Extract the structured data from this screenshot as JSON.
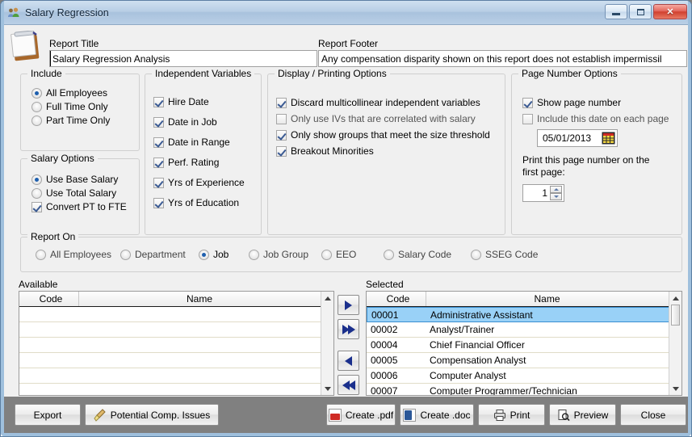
{
  "window": {
    "title": "Salary Regression",
    "icon": "people-group-icon",
    "minimize_label": "Minimize",
    "maximize_label": "Maximize",
    "close_label": "✕"
  },
  "report": {
    "title_label": "Report Title",
    "title_value": "Salary Regression Analysis",
    "footer_label": "Report Footer",
    "footer_value": "Any compensation disparity shown on this report does not establish impermissil"
  },
  "include_group": {
    "title": "Include",
    "options": [
      {
        "label": "All Employees",
        "selected": true
      },
      {
        "label": "Full Time Only",
        "selected": false
      },
      {
        "label": "Part Time Only",
        "selected": false
      }
    ]
  },
  "salary_options_group": {
    "title": "Salary Options",
    "radios": [
      {
        "label": "Use Base Salary",
        "selected": true
      },
      {
        "label": "Use Total Salary",
        "selected": false
      }
    ],
    "checkbox": {
      "label": "Convert PT to FTE",
      "checked": true
    }
  },
  "independent_variables_group": {
    "title": "Independent Variables",
    "options": [
      {
        "label": "Hire Date",
        "checked": true
      },
      {
        "label": "Date in Job",
        "checked": true
      },
      {
        "label": "Date in Range",
        "checked": true
      },
      {
        "label": "Perf. Rating",
        "checked": true
      },
      {
        "label": "Yrs of Experience",
        "checked": true
      },
      {
        "label": "Yrs of Education",
        "checked": true
      }
    ]
  },
  "display_printing_group": {
    "title": "Display / Printing Options",
    "options": [
      {
        "label": "Discard multicollinear independent variables",
        "checked": true
      },
      {
        "label": "Only use IVs that are correlated with salary",
        "checked": false
      },
      {
        "label": "Only show groups that meet the size threshold",
        "checked": true
      },
      {
        "label": "Breakout Minorities",
        "checked": true
      }
    ]
  },
  "page_number_group": {
    "title": "Page Number Options",
    "show_page_number": {
      "label": "Show page number",
      "checked": true
    },
    "include_date": {
      "label": "Include this date on each page",
      "checked": false
    },
    "date_value": "05/01/2013",
    "calendar_icon": "calendar-icon",
    "first_page_label_line1": "Print this page number on the",
    "first_page_label_line2": "first page:",
    "first_page_value": "1"
  },
  "report_on_group": {
    "title": "Report On",
    "options": [
      {
        "label": "All Employees",
        "selected": false
      },
      {
        "label": "Department",
        "selected": false
      },
      {
        "label": "Job",
        "selected": true
      },
      {
        "label": "Job Group",
        "selected": false
      },
      {
        "label": "EEO",
        "selected": false
      },
      {
        "label": "Salary Code",
        "selected": false
      },
      {
        "label": "SSEG Code",
        "selected": false
      }
    ]
  },
  "available_list": {
    "label": "Available",
    "columns": [
      "Code",
      "Name"
    ],
    "rows": []
  },
  "selected_list": {
    "label": "Selected",
    "columns": [
      "Code",
      "Name"
    ],
    "rows": [
      {
        "code": "00001",
        "name": "Administrative Assistant",
        "selected": true
      },
      {
        "code": "00002",
        "name": "Analyst/Trainer",
        "selected": false
      },
      {
        "code": "00004",
        "name": "Chief Financial Officer",
        "selected": false
      },
      {
        "code": "00005",
        "name": "Compensation Analyst",
        "selected": false
      },
      {
        "code": "00006",
        "name": "Computer Analyst",
        "selected": false
      },
      {
        "code": "00007",
        "name": "Computer Programmer/Technician",
        "selected": false
      }
    ]
  },
  "transfer_buttons": [
    {
      "name": "move-right-button",
      "glyph": "▶"
    },
    {
      "name": "move-all-right-button",
      "glyph": "▶▶"
    },
    {
      "name": "move-left-button",
      "glyph": "◀"
    },
    {
      "name": "move-all-left-button",
      "glyph": "◀◀"
    }
  ],
  "footer_buttons": {
    "export": "Export",
    "potential_comp_issues": "Potential Comp. Issues",
    "create_pdf": "Create .pdf",
    "create_doc": "Create .doc",
    "print": "Print",
    "preview": "Preview",
    "close": "Close"
  },
  "colors": {
    "titlebar": "#b8cee5",
    "window_bg": "#f0f0f0",
    "button_bar": "#808080",
    "selection": "#99d1f7",
    "accent_blue": "#1a2f8c",
    "close_red": "#d0402f"
  }
}
